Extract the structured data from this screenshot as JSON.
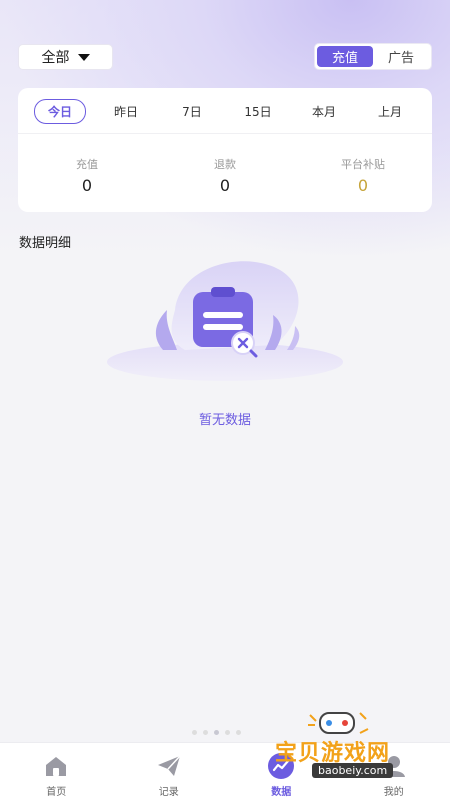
{
  "header": {
    "scope_label": "全部",
    "mode_tabs": [
      {
        "label": "充值",
        "active": true
      },
      {
        "label": "广告",
        "active": false
      }
    ]
  },
  "periods": [
    {
      "label": "今日",
      "active": true
    },
    {
      "label": "昨日",
      "active": false
    },
    {
      "label": "7日",
      "active": false
    },
    {
      "label": "15日",
      "active": false
    },
    {
      "label": "本月",
      "active": false
    },
    {
      "label": "上月",
      "active": false
    }
  ],
  "stats": [
    {
      "label": "充值",
      "value": "0"
    },
    {
      "label": "退款",
      "value": "0"
    },
    {
      "label": "平台补贴",
      "value": "0"
    }
  ],
  "section_title": "数据明细",
  "empty_text": "暂无数据",
  "bottom_nav": [
    {
      "label": "首页",
      "icon": "home-icon",
      "active": false
    },
    {
      "label": "记录",
      "icon": "send-icon",
      "active": false
    },
    {
      "label": "数据",
      "icon": "chart-icon",
      "active": true
    },
    {
      "label": "我的",
      "icon": "user-icon",
      "active": false
    }
  ],
  "watermark": {
    "title": "宝贝游戏网",
    "url": "baobeiy.com"
  },
  "colors": {
    "accent": "#6c5ce0",
    "gold": "#c6a43a",
    "background": "#f4f4f7"
  }
}
